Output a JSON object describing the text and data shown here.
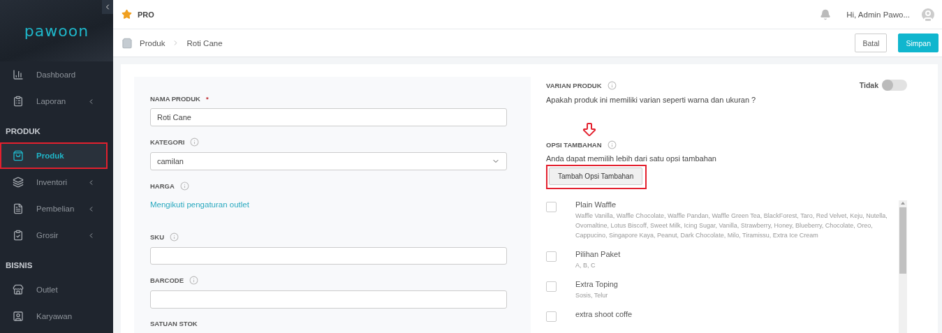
{
  "sidebar": {
    "logo": "pawoon",
    "items": [
      {
        "kind": "item",
        "label": "Dashboard",
        "selected": false,
        "expandable": false,
        "highlighted": false
      },
      {
        "kind": "item",
        "label": "Laporan",
        "selected": false,
        "expandable": true,
        "highlighted": false
      },
      {
        "kind": "section",
        "label": "PRODUK"
      },
      {
        "kind": "item",
        "label": "Produk",
        "selected": true,
        "expandable": false,
        "highlighted": true
      },
      {
        "kind": "item",
        "label": "Inventori",
        "selected": false,
        "expandable": true,
        "highlighted": false
      },
      {
        "kind": "item",
        "label": "Pembelian",
        "selected": false,
        "expandable": true,
        "highlighted": false
      },
      {
        "kind": "item",
        "label": "Grosir",
        "selected": false,
        "expandable": true,
        "highlighted": false
      },
      {
        "kind": "section",
        "label": "BISNIS"
      },
      {
        "kind": "item",
        "label": "Outlet",
        "selected": false,
        "expandable": false,
        "highlighted": false
      },
      {
        "kind": "item",
        "label": "Karyawan",
        "selected": false,
        "expandable": false,
        "highlighted": false
      }
    ]
  },
  "topbar": {
    "plan": "PRO",
    "user": "Hi, Admin Pawo..."
  },
  "breadcrumb": [
    "Produk",
    "Roti Cane"
  ],
  "actions": [
    {
      "kind": "secondary",
      "label": "Batal"
    },
    {
      "kind": "primary",
      "label": "Simpan"
    }
  ],
  "form": {
    "fields": [
      {
        "kind": "input",
        "label": "NAMA PRODUK",
        "required_mark": "*",
        "info": false,
        "value": "Roti Cane"
      },
      {
        "kind": "select",
        "label": "KATEGORI",
        "info": true,
        "value": "camilan"
      },
      {
        "kind": "link",
        "label": "HARGA",
        "info": true,
        "value": "Mengikuti pengaturan outlet"
      },
      {
        "kind": "input",
        "label": "SKU",
        "info": true
      },
      {
        "kind": "input",
        "label": "BARCODE",
        "info": true
      },
      {
        "kind": "heading",
        "label": "SATUAN STOK",
        "info": false
      }
    ]
  },
  "variant": {
    "title": "VARIAN PRODUK",
    "description": "Apakah produk ini memiliki varian seperti warna dan ukuran ?",
    "toggle_label": "Tidak",
    "on": false
  },
  "addons": {
    "title": "OPSI TAMBAHAN",
    "description": "Anda dapat memilih lebih dari satu opsi tambahan",
    "button": "Tambah Opsi Tambahan",
    "highlighted": true,
    "options": [
      {
        "name": "Plain Waffle",
        "items": "Waffle Vanilla, Waffle Chocolate, Waffle Pandan, Waffle Green Tea, BlackForest, Taro, Red Velvet, Keju, Nutella, Ovomaltine, Lotus Biscoff, Sweet Milk, Icing Sugar, Vanilla, Strawberry, Honey, Blueberry, Chocolate, Oreo, Cappucino, Singapore Kaya, Peanut, Dark Chocolate, Milo, Tiramissu, Extra Ice Cream",
        "checked": false
      },
      {
        "name": "Pilihan Paket",
        "items": "A, B, C",
        "checked": false
      },
      {
        "name": "Extra Toping",
        "items": "Sosis, Telur",
        "checked": false
      },
      {
        "name": "extra shoot coffe",
        "checked": false
      }
    ]
  }
}
